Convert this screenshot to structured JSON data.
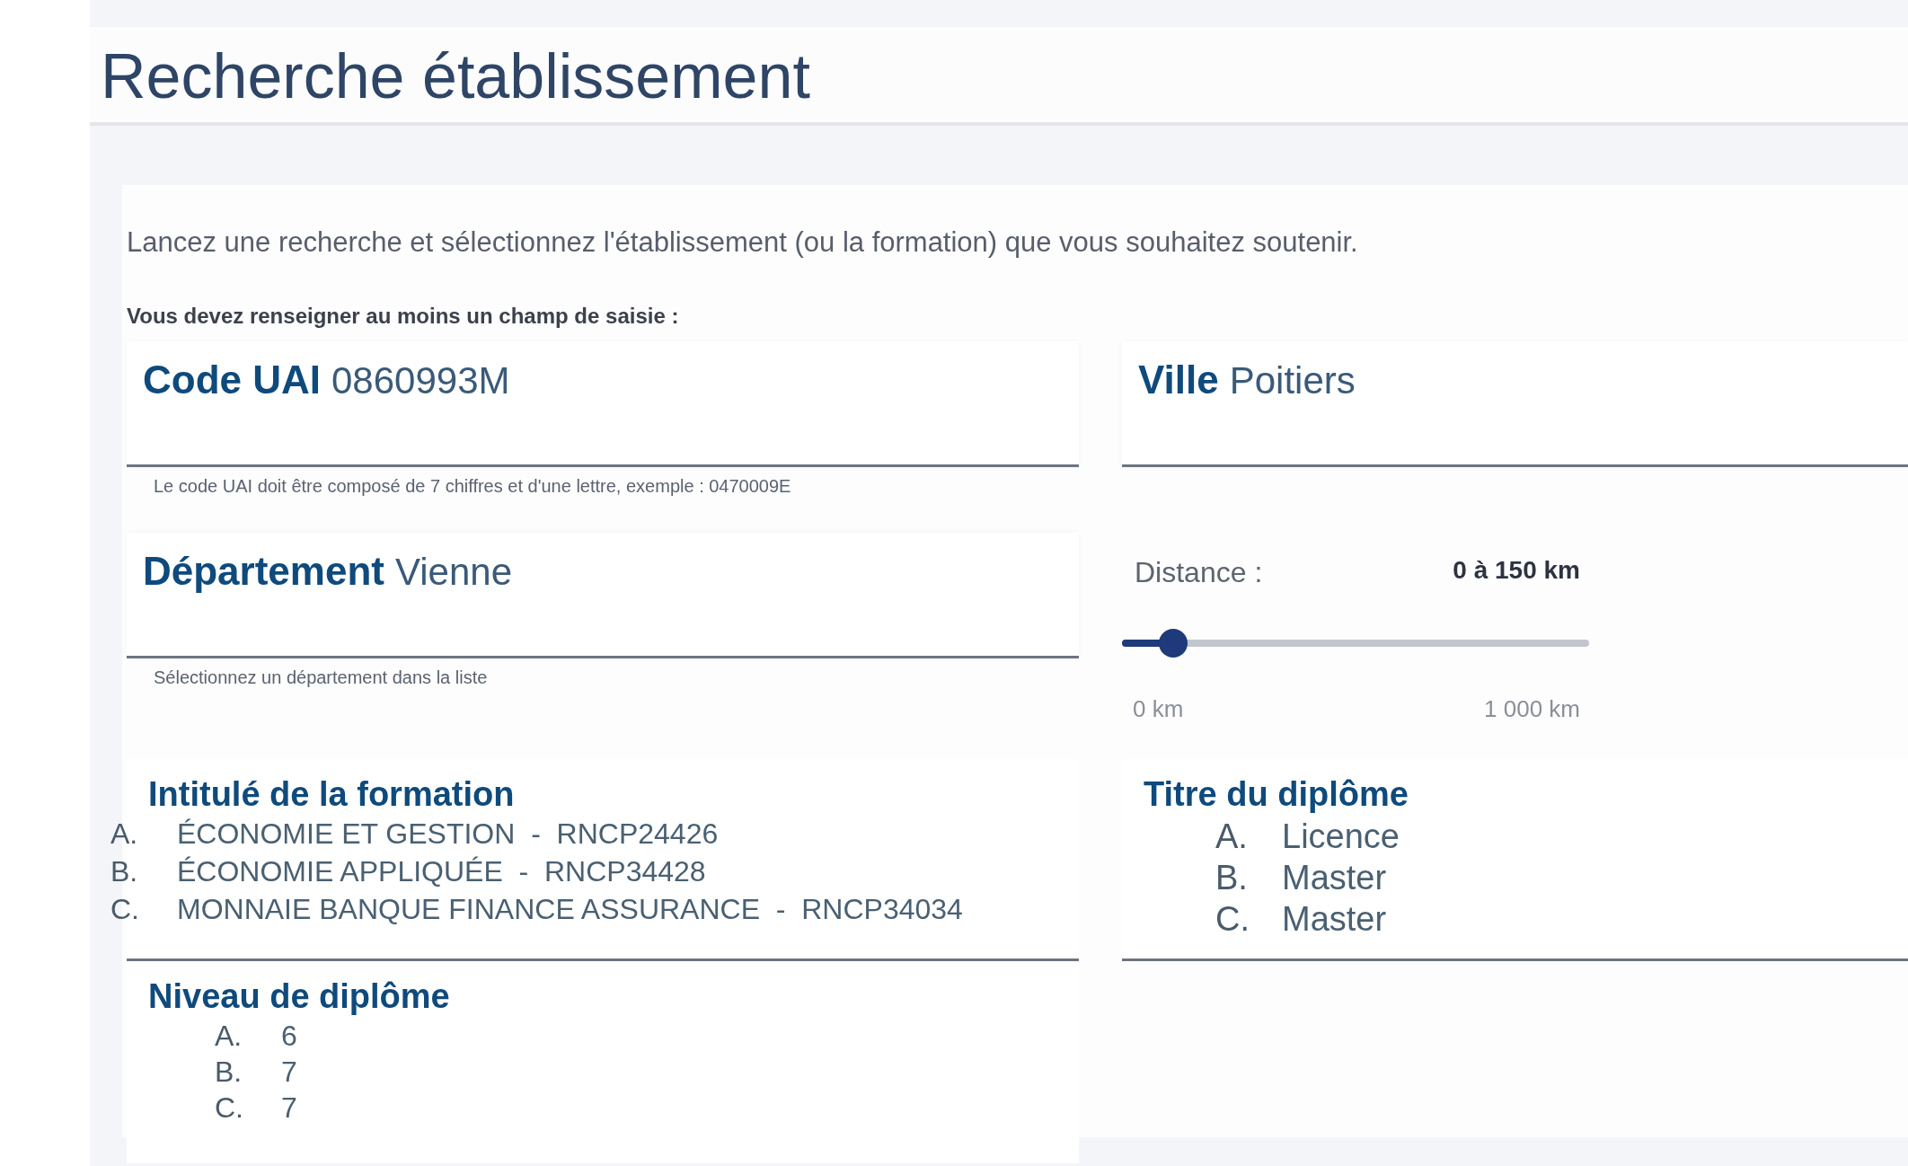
{
  "page": {
    "title": "Recherche établissement"
  },
  "intro": "Lancez une recherche et sélectionnez l'établissement (ou la formation) que vous souhaitez soutenir.",
  "requirement": "Vous devez renseigner au moins un champ de saisie :",
  "fields": [
    {
      "kind": "text",
      "label": "Code UAI",
      "value": "0860993M",
      "hint": "Le code UAI doit être composé de 7 chiffres et d'une lettre, exemple : 0470009E"
    },
    {
      "kind": "text",
      "label": "Ville",
      "value": "Poitiers"
    },
    {
      "kind": "text",
      "label": "Département",
      "value": "Vienne",
      "hint": "Sélectionnez un département dans la liste"
    },
    {
      "kind": "slider",
      "label": "Distance :",
      "reading": "0 à 150 km",
      "min_label": "0 km",
      "max_label": "1 000 km",
      "level": 0.11
    },
    {
      "kind": "list",
      "label": "Intitulé de la formation",
      "items": [
        {
          "marker": "A.",
          "text": "ÉCONOMIE ET GESTION  -  RNCP24426"
        },
        {
          "marker": "B.",
          "text": "ÉCONOMIE APPLIQUÉE  -  RNCP34428"
        },
        {
          "marker": "C.",
          "text": "MONNAIE BANQUE FINANCE ASSURANCE  -  RNCP34034"
        }
      ]
    },
    {
      "kind": "list",
      "label": "Titre du diplôme",
      "items": [
        {
          "marker": "A.",
          "text": "Licence"
        },
        {
          "marker": "B.",
          "text": "Master"
        },
        {
          "marker": "C.",
          "text": "Master"
        }
      ]
    },
    {
      "kind": "list",
      "label": "Niveau de diplôme",
      "items": [
        {
          "marker": "A.",
          "text": "6"
        },
        {
          "marker": "B.",
          "text": "7"
        },
        {
          "marker": "C.",
          "text": "7"
        }
      ]
    }
  ]
}
